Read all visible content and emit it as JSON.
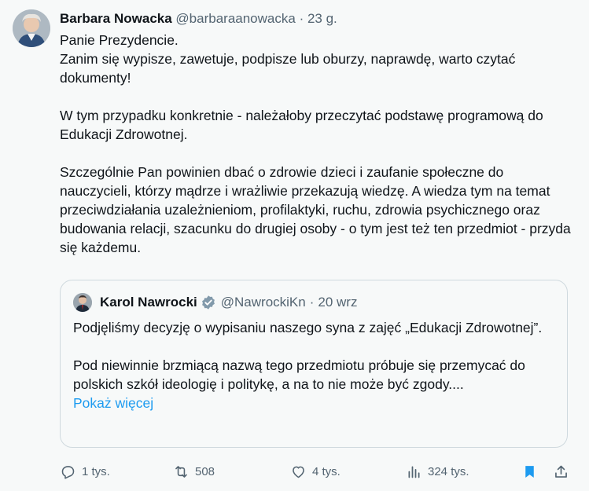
{
  "author": {
    "name": "Barbara Nowacka",
    "handle": "@barbaraanowacka",
    "separator": "·",
    "time": "23 g."
  },
  "tweet_paragraphs": [
    "Panie Prezydencie.",
    "Zanim się wypisze, zawetuje, podpisze lub oburzy, naprawdę, warto czytać dokumenty!",
    "W tym przypadku konkretnie - należałoby przeczytać podstawę programową do Edukacji Zdrowotnej.",
    "Szczególnie Pan powinien dbać o zdrowie dzieci i zaufanie społeczne do nauczycieli, którzy mądrze i wrażliwie przekazują wiedzę. A wiedza tym na temat przeciwdziałania uzależnieniom, profilaktyki,  ruchu, zdrowia psychicznego oraz budowania relacji, szacunku do drugiej osoby - o tym jest też ten przedmiot - przyda się każdemu."
  ],
  "quoted": {
    "name": "Karol Nawrocki",
    "handle": "@NawrockiKn",
    "separator": "·",
    "time": "20 wrz",
    "paragraph1": "Podjęliśmy decyzję o wypisaniu naszego syna z zajęć „Edukacji Zdrowotnej”.",
    "paragraph2": "Pod niewinnie brzmiącą nazwą tego przedmiotu próbuje się przemycać do polskich szkół ideologię i politykę, a na to nie może być zgody....",
    "show_more": "Pokaż więcej"
  },
  "actions": {
    "replies": "1 tys.",
    "reposts": "508",
    "likes": "4 tys.",
    "views": "324 tys."
  },
  "colors": {
    "accent": "#1d9bf0",
    "muted": "#536471",
    "text": "#0f1419",
    "background": "#f7f9f9"
  }
}
